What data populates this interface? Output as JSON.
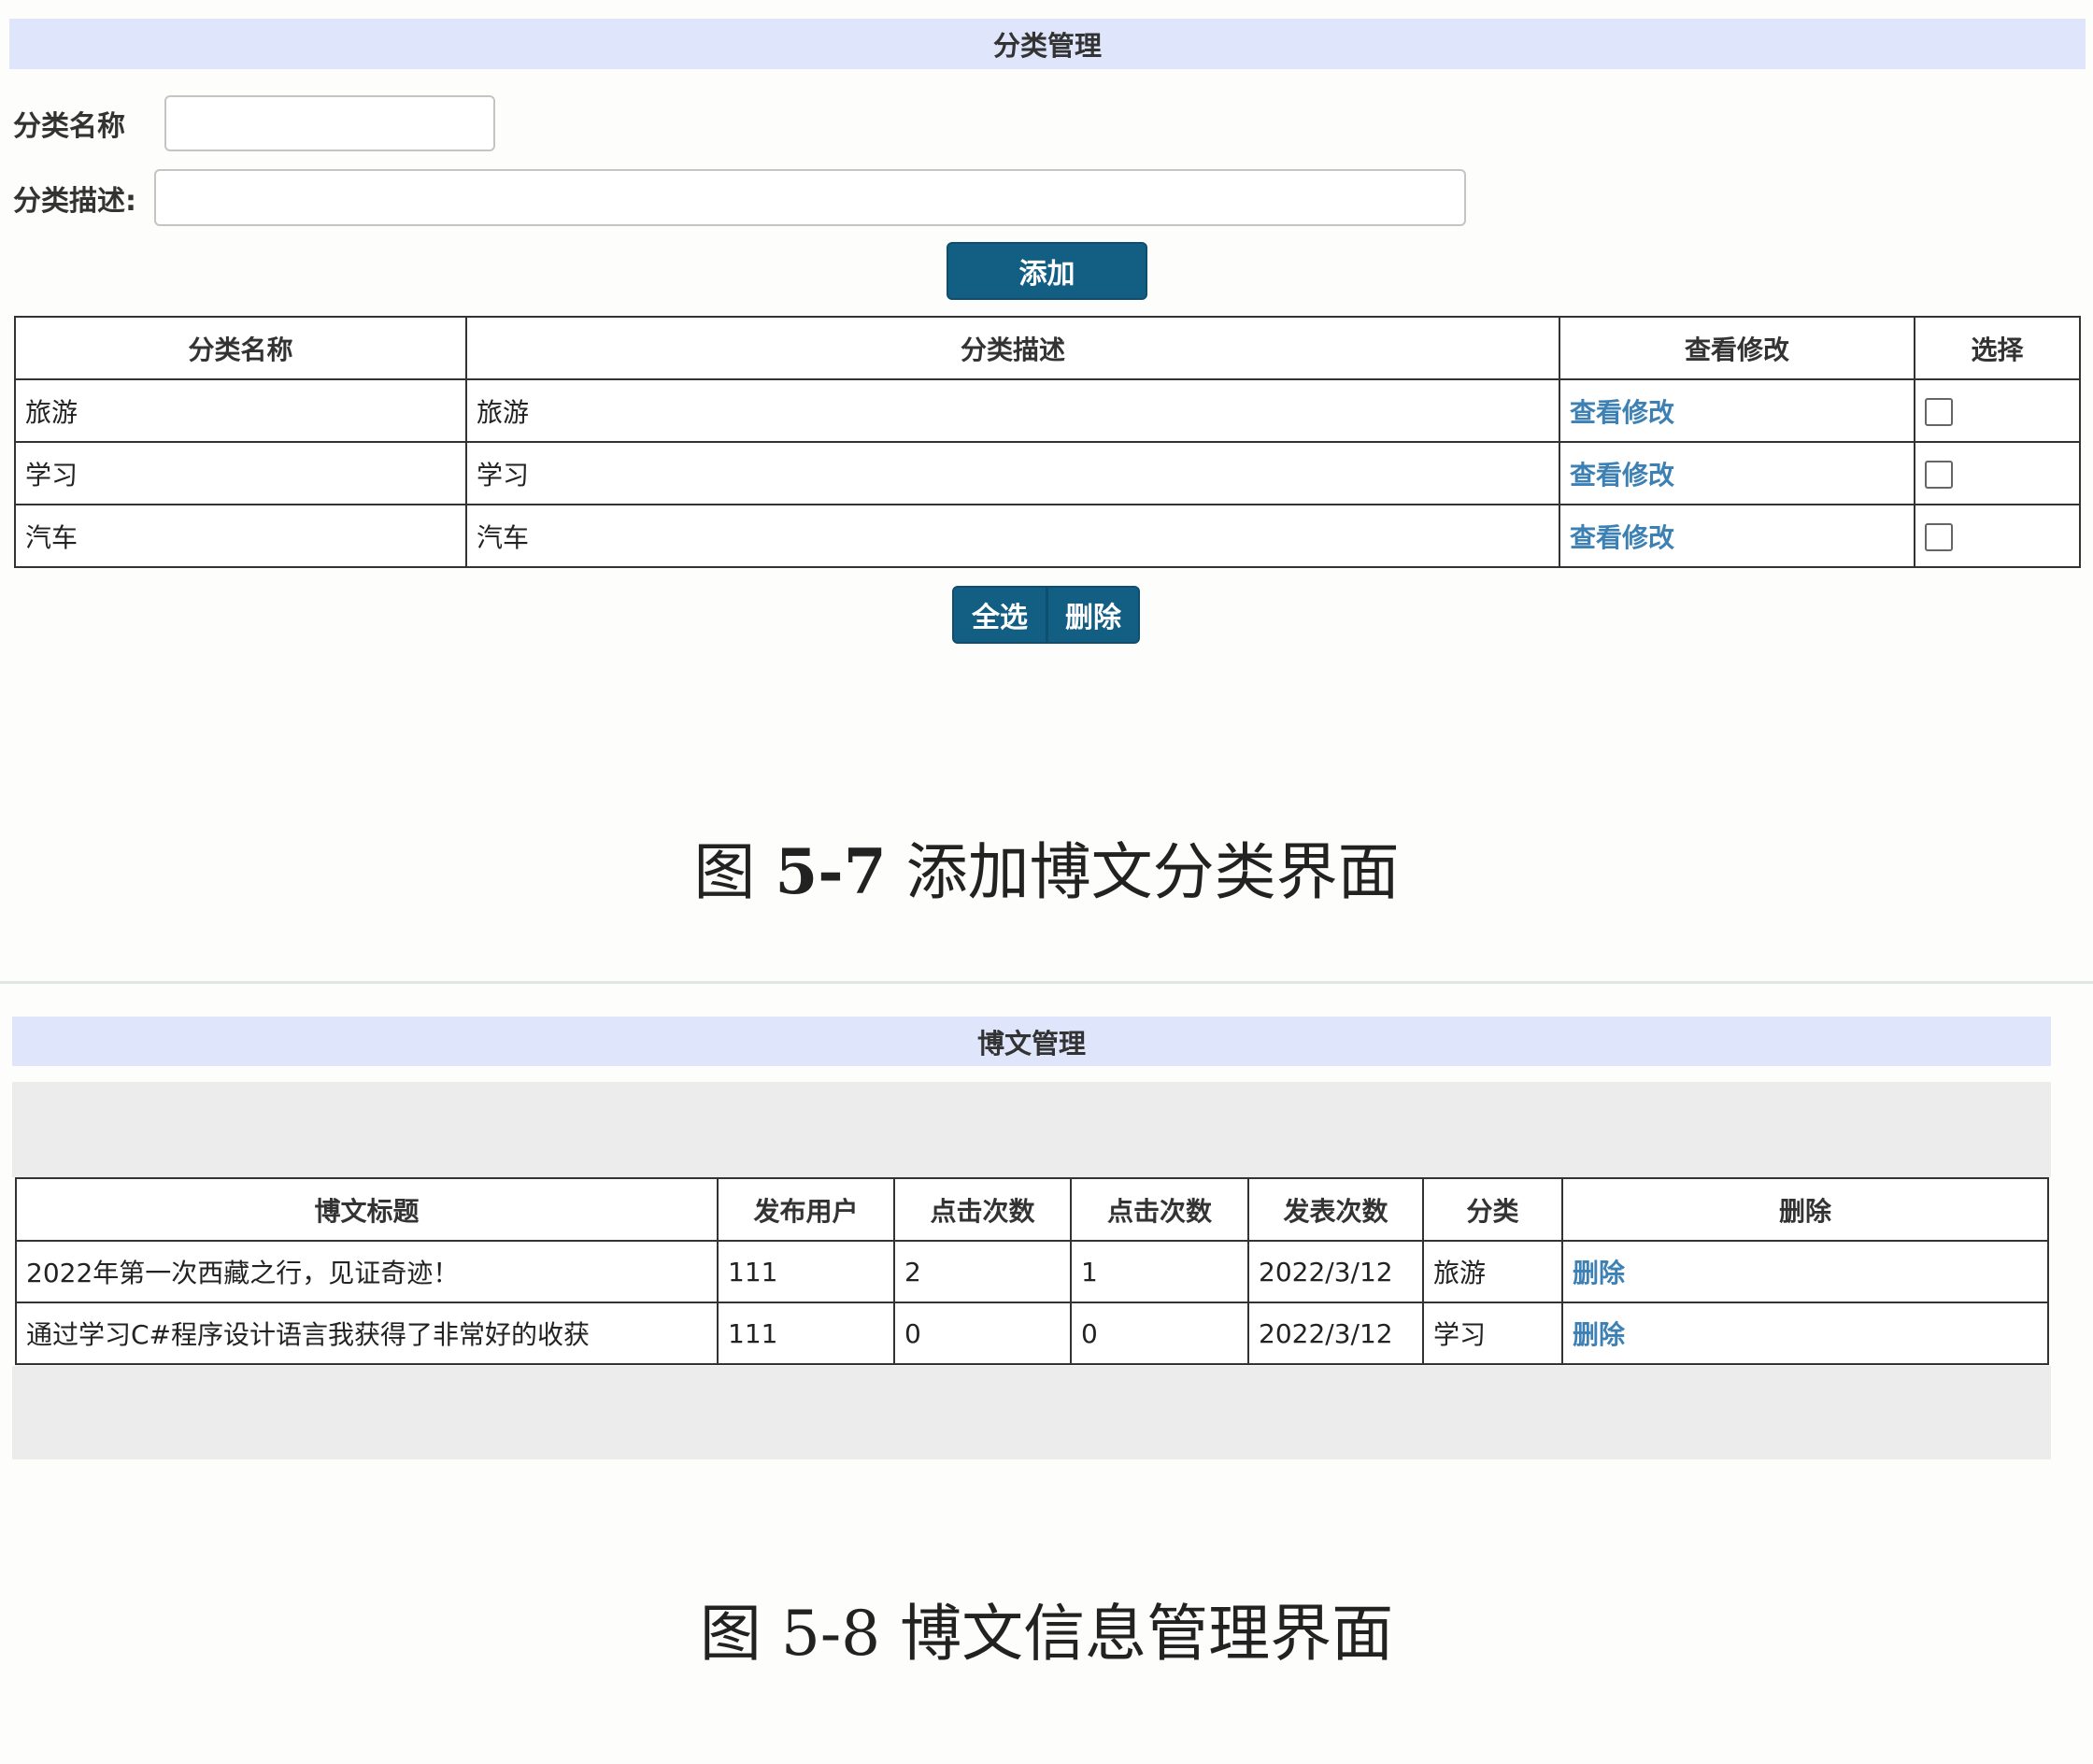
{
  "fig1": {
    "header": "分类管理",
    "name_label": "分类名称",
    "name_value": "",
    "desc_label": "分类描述:",
    "desc_value": "",
    "add_label": "添加",
    "columns": [
      "分类名称",
      "分类描述",
      "查看修改",
      "选择"
    ],
    "rows": [
      {
        "name": "旅游",
        "desc": "旅游",
        "link": "查看修改"
      },
      {
        "name": "学习",
        "desc": "学习",
        "link": "查看修改"
      },
      {
        "name": "汽车",
        "desc": "汽车",
        "link": "查看修改"
      }
    ],
    "select_all_label": "全选",
    "delete_label": "删除",
    "caption_fig": "图",
    "caption_num": "5-7",
    "caption_text": "添加博文分类界面"
  },
  "fig2": {
    "header": "博文管理",
    "columns": [
      "博文标题",
      "发布用户",
      "点击次数",
      "点击次数",
      "发表次数",
      "分类",
      "删除"
    ],
    "rows": [
      {
        "title": "2022年第一次西藏之行，见证奇迹！",
        "user": "111",
        "clicks": "2",
        "clicks2": "1",
        "date": "2022/3/12",
        "category": "旅游",
        "del": "删除"
      },
      {
        "title": "通过学习C#程序设计语言我获得了非常好的收获",
        "user": "111",
        "clicks": "0",
        "clicks2": "0",
        "date": "2022/3/12",
        "category": "学习",
        "del": "删除"
      }
    ],
    "caption_fig": "图",
    "caption_num": "5-8",
    "caption_text": "博文信息管理界面"
  },
  "colors": {
    "header_bg": "#dfe6fb",
    "button_bg": "#135f84",
    "link": "#3c80b4",
    "border": "#333333",
    "gray_band": "#ececec"
  }
}
